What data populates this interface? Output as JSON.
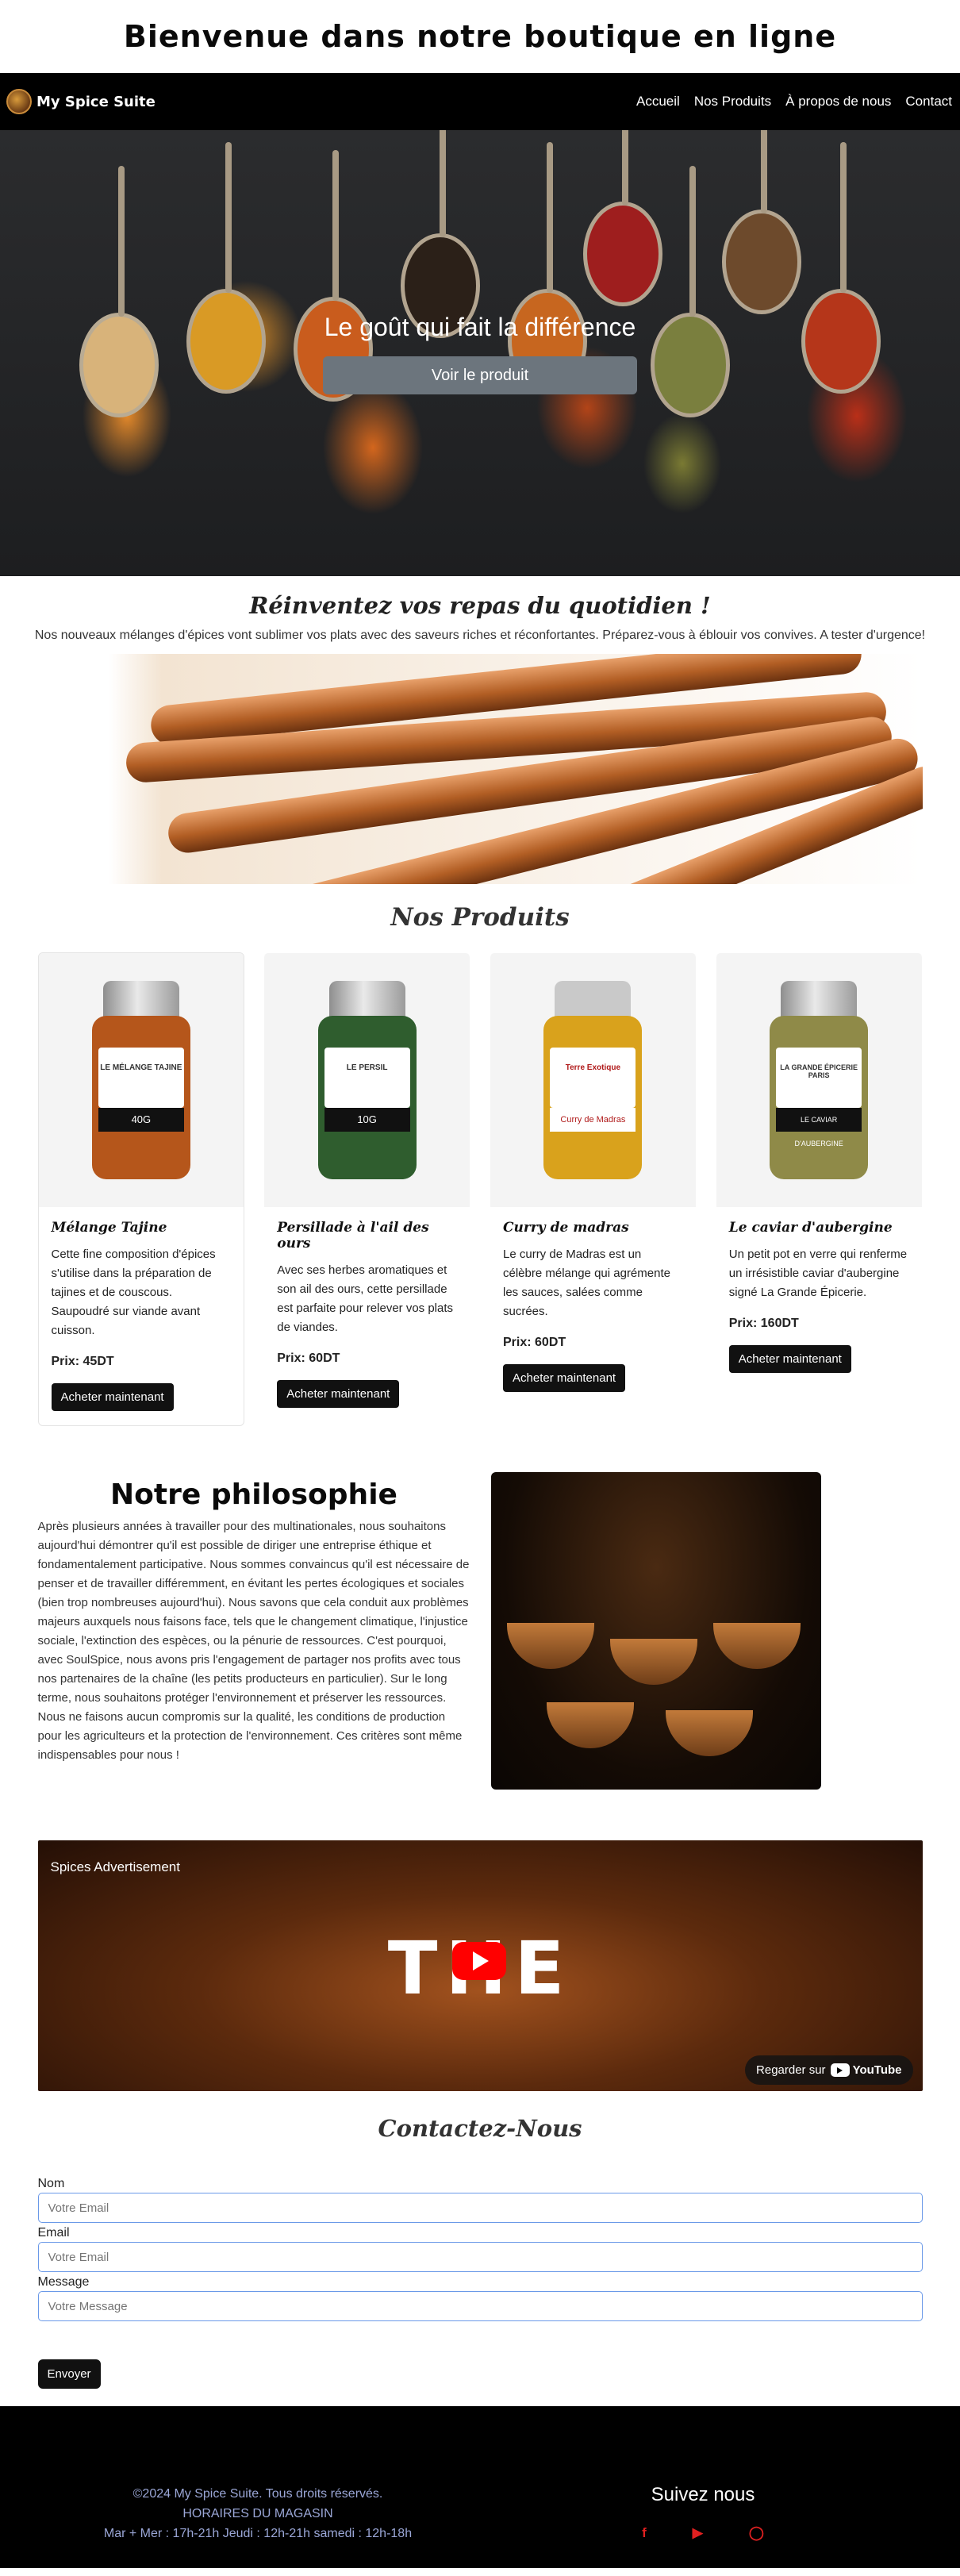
{
  "page": {
    "main_title": "Bienvenue dans notre boutique en ligne"
  },
  "navbar": {
    "brand": "My Spice Suite",
    "links": [
      "Accueil",
      "Nos Produits",
      "À propos de nous",
      "Contact"
    ]
  },
  "hero": {
    "tagline": "Le goût qui fait la différence",
    "button": "Voir le produit"
  },
  "intro": {
    "title": "Réinventez vos repas du quotidien !",
    "text": "Nos nouveaux mélanges d'épices vont sublimer vos plats avec des saveurs riches et réconfortantes. Préparez-vous à éblouir vos convives. A tester d'urgence!"
  },
  "products": {
    "title": "Nos Produits",
    "items": [
      {
        "name": "Mélange Tajine",
        "description": "Cette fine composition d'épices s'utilise dans la préparation de tajines et de couscous. Saupoudré sur viande avant cuisson.",
        "price": "Prix: 45DT",
        "button": "Acheter maintenant",
        "jar_label": "LE MÉLANGE TAJINE",
        "jar_weight": "40G",
        "jar_color": "#b5561b"
      },
      {
        "name": "Persillade à l'ail des ours",
        "description": "Avec ses herbes aromatiques et son ail des ours, cette persillade est parfaite pour relever vos plats de viandes.",
        "price": "Prix: 60DT",
        "button": "Acheter maintenant",
        "jar_label": "LE PERSIL",
        "jar_weight": "10G",
        "jar_color": "#2f5d2e"
      },
      {
        "name": "Curry de madras",
        "description": "Le curry de Madras est un célèbre mélange qui agrémente les sauces, salées comme sucrées.",
        "price": "Prix: 60DT",
        "button": "Acheter maintenant",
        "jar_label": "Terre Exotique",
        "jar_weight": "Curry de Madras",
        "jar_color": "#d9a21c"
      },
      {
        "name": "Le caviar d'aubergine",
        "description": "Un petit pot en verre qui renferme un irrésistible caviar d'aubergine signé La Grande Épicerie.",
        "price": "Prix: 160DT",
        "button": "Acheter maintenant",
        "jar_label": "LA GRANDE ÉPICERIE PARIS",
        "jar_weight": "LE CAVIAR D'AUBERGINE",
        "jar_color": "#8f8a48"
      }
    ]
  },
  "philosophy": {
    "title": "Notre philosophie",
    "text": "Après plusieurs années à travailler pour des multinationales, nous souhaitons aujourd'hui démontrer qu'il est possible de diriger une entreprise éthique et fondamentalement participative. Nous sommes convaincus qu'il est nécessaire de penser et de travailler différemment, en évitant les pertes écologiques et sociales (bien trop nombreuses aujourd'hui). Nous savons que cela conduit aux problèmes majeurs auxquels nous faisons face, tels que le changement climatique, l'injustice sociale, l'extinction des espèces, ou la pénurie de ressources. C'est pourquoi, avec SoulSpice, nous avons pris l'engagement de partager nos profits avec tous nos partenaires de la chaîne (les petits producteurs en particulier). Sur le long terme, nous souhaitons protéger l'environnement et préserver les ressources. Nous ne faisons aucun compromis sur la qualité, les conditions de production pour les agriculteurs et la protection de l'environnement. Ces critères sont même indispensables pour nous !"
  },
  "video": {
    "title": "Spices Advertisement",
    "overlay_text": "THE",
    "watch_on": "Regarder sur",
    "platform": "YouTube"
  },
  "contact": {
    "title": "Contactez-Nous",
    "name_label": "Nom",
    "name_placeholder": "Votre Email",
    "email_label": "Email",
    "email_placeholder": "Votre Email",
    "message_label": "Message",
    "message_placeholder": "Votre Message",
    "submit": "Envoyer"
  },
  "footer": {
    "copyright": "©2024 My Spice Suite. Tous droits réservés.",
    "hours_title": "HORAIRES DU MAGASIN",
    "hours": "Mar + Mer : 17h-21h Jeudi : 12h-21h samedi : 12h-18h",
    "follow": "Suivez nous",
    "socials": [
      "facebook-icon",
      "youtube-icon",
      "instagram-icon"
    ]
  }
}
